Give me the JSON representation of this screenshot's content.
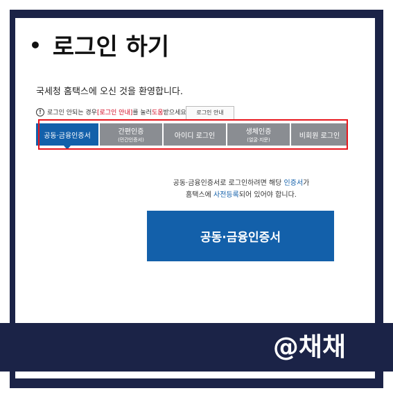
{
  "slide": {
    "bullet": "•",
    "title": "로그인 하기"
  },
  "page": {
    "welcome": "국세청 홈택스에 오신 것을 환영합니다.",
    "help": {
      "icon": "!",
      "text_1": "로그인 안되는 경우 ",
      "text_red_1": "[로그인 안내]",
      "text_2": "를 눌러 ",
      "text_red_2": "도움",
      "text_3": "받으세요.",
      "button": "로그인 안내"
    },
    "tabs": [
      {
        "label": "공동·금융인증서",
        "sub": "",
        "active": true
      },
      {
        "label": "간편인증",
        "sub": "(민간인증서)",
        "active": false
      },
      {
        "label": "아이디 로그인",
        "sub": "",
        "active": false
      },
      {
        "label": "생체인증",
        "sub": "(얼굴·지문)",
        "active": false
      },
      {
        "label": "비회원 로그인",
        "sub": "",
        "active": false
      }
    ],
    "notice": {
      "line1_a": "공동·금융인증서로 로그인하려면 해당 ",
      "line1_b": "인증서",
      "line1_c": "가",
      "line2_a": "홈택스에 ",
      "line2_b": "사전등록",
      "line2_c": "되어 있어야 합니다."
    },
    "cert_button": "공동·금융인증서"
  },
  "watermark": "@채채",
  "colors": {
    "navy": "#1b2347",
    "blue": "#1360aa",
    "gray_tab": "#8a8d92",
    "red": "#e8141b"
  }
}
